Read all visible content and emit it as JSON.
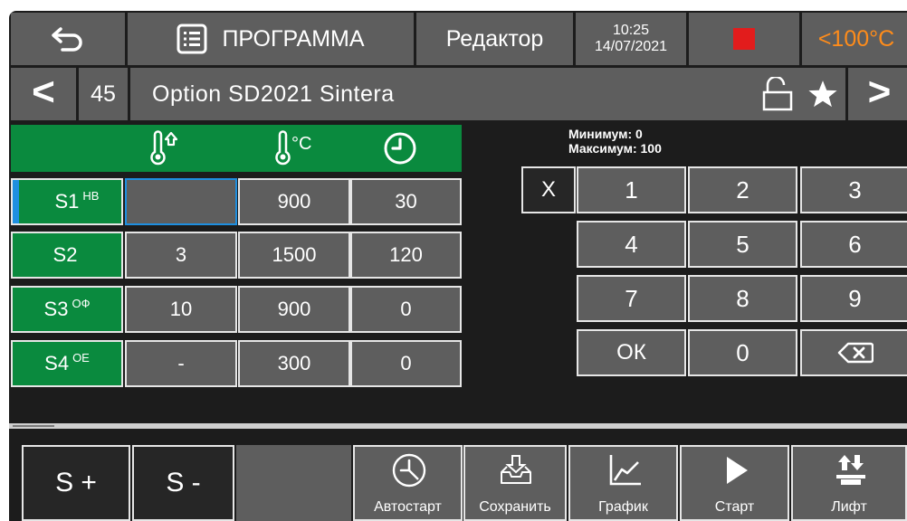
{
  "header": {
    "title": "ПРОГРАММА",
    "mode": "Редактор",
    "time": "10:25",
    "date": "14/07/2021",
    "temp": "<100°C",
    "colors": {
      "stop": "#e21c1c",
      "temp": "#ff8c1a"
    }
  },
  "program": {
    "number": "45",
    "name": "Option SD2021 Sintera",
    "prev_label": "<",
    "next_label": ">"
  },
  "table": {
    "headers": {
      "rate_icon": "thermometer-up-icon",
      "temp_unit": "°C",
      "time_icon": "clock-icon"
    },
    "rows": [
      {
        "label": "S1",
        "badge": "НВ",
        "rate": "",
        "temp": "900",
        "time": "30"
      },
      {
        "label": "S2",
        "badge": "",
        "rate": "3",
        "temp": "1500",
        "time": "120"
      },
      {
        "label": "S3",
        "badge": "ОФ",
        "rate": "10",
        "temp": "900",
        "time": "0"
      },
      {
        "label": "S4",
        "badge": "ОЕ",
        "rate": "-",
        "temp": "300",
        "time": "0"
      }
    ]
  },
  "keypad": {
    "min_label": "Минимум: 0",
    "max_label": "Максимум: 100",
    "clear": "X",
    "keys": [
      "1",
      "2",
      "3",
      "4",
      "5",
      "6",
      "7",
      "8",
      "9"
    ],
    "ok": "ОК",
    "zero": "0"
  },
  "footer": {
    "add_step": "S +",
    "remove_step": "S -",
    "autostart": "Автостарт",
    "save": "Сохранить",
    "graph": "График",
    "start": "Старт",
    "lift": "Лифт"
  },
  "colors": {
    "green": "#0a8a3e",
    "cell": "#5e5e5e",
    "accent": "#1e8fe0"
  }
}
